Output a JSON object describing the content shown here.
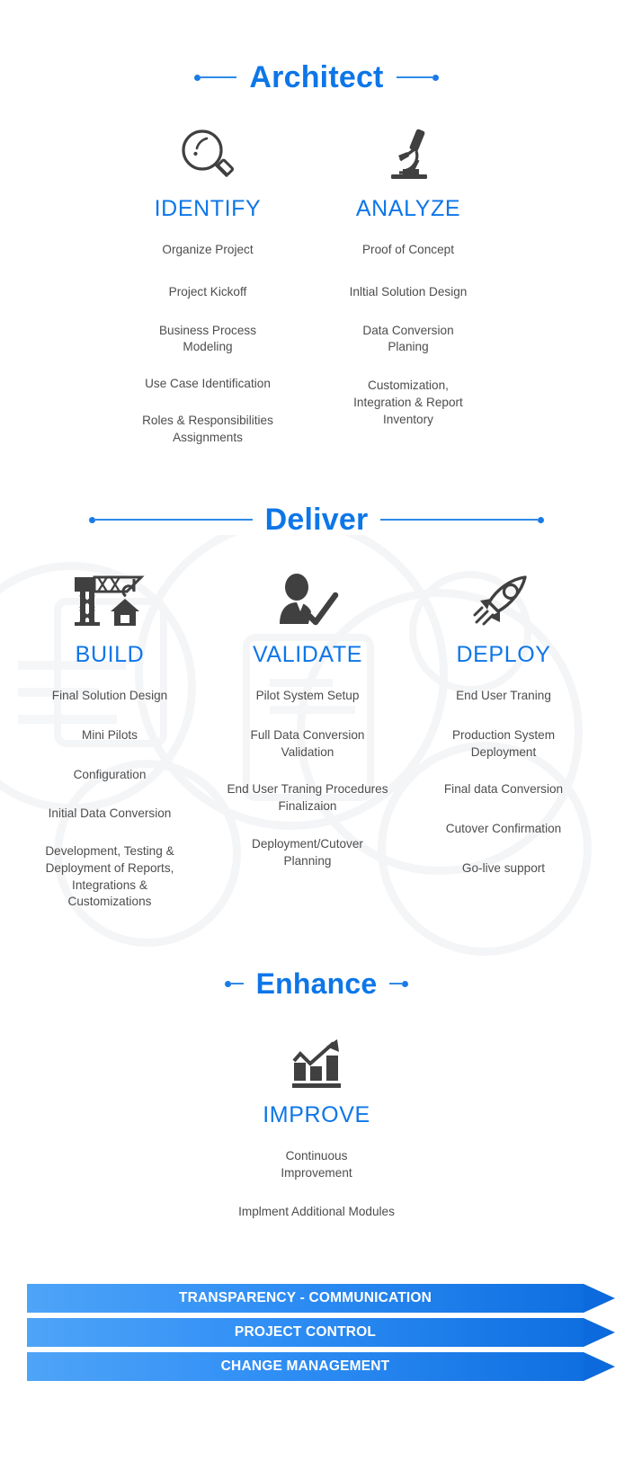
{
  "theme": {
    "accent_blue": "#0d76e8",
    "icon_dark": "#404040",
    "body_text": "#4d4d4d",
    "banner_light": "#4ea4f7",
    "banner_dark": "#0f6fe0"
  },
  "sections": [
    {
      "id": "architect",
      "title": "Architect",
      "columns": [
        {
          "id": "identify",
          "title": "IDENTIFY",
          "icon": "magnifier-icon",
          "items": [
            "Organize Project",
            "Project Kickoff",
            "Business Process Modeling",
            "Use Case Identification",
            "Roles & Responsibilities Assignments"
          ]
        },
        {
          "id": "analyze",
          "title": "ANALYZE",
          "icon": "microscope-icon",
          "items": [
            "Proof of Concept",
            "Inltial Solution Design",
            "Data Conversion Planing",
            "Customization, Integration & Report Inventory"
          ]
        }
      ]
    },
    {
      "id": "deliver",
      "title": "Deliver",
      "columns": [
        {
          "id": "build",
          "title": "BUILD",
          "icon": "crane-house-icon",
          "items": [
            "Final Solution Design",
            "Mini Pilots",
            "Configuration",
            "Initial Data Conversion",
            "Development, Testing & Deployment of Reports, Integrations & Customizations"
          ]
        },
        {
          "id": "validate",
          "title": "VALIDATE",
          "icon": "person-checkmark-icon",
          "items": [
            "Pilot System Setup",
            "Full Data Conversion Validation",
            "End User Traning Procedures Finalizaion",
            "Deployment/Cutover Planning"
          ]
        },
        {
          "id": "deploy",
          "title": "DEPLOY",
          "icon": "rocket-icon",
          "items": [
            "End User Traning",
            "Production System Deployment",
            "Final data Conversion",
            "Cutover Confirmation",
            "Go-live support"
          ]
        }
      ]
    },
    {
      "id": "enhance",
      "title": "Enhance",
      "columns": [
        {
          "id": "improve",
          "title": "IMPROVE",
          "icon": "growth-chart-icon",
          "items": [
            "Continuous Improvement",
            "Implment Additional Modules"
          ]
        }
      ]
    }
  ],
  "banners": [
    "TRANSPARENCY - COMMUNICATION",
    "PROJECT CONTROL",
    "CHANGE MANAGEMENT"
  ]
}
